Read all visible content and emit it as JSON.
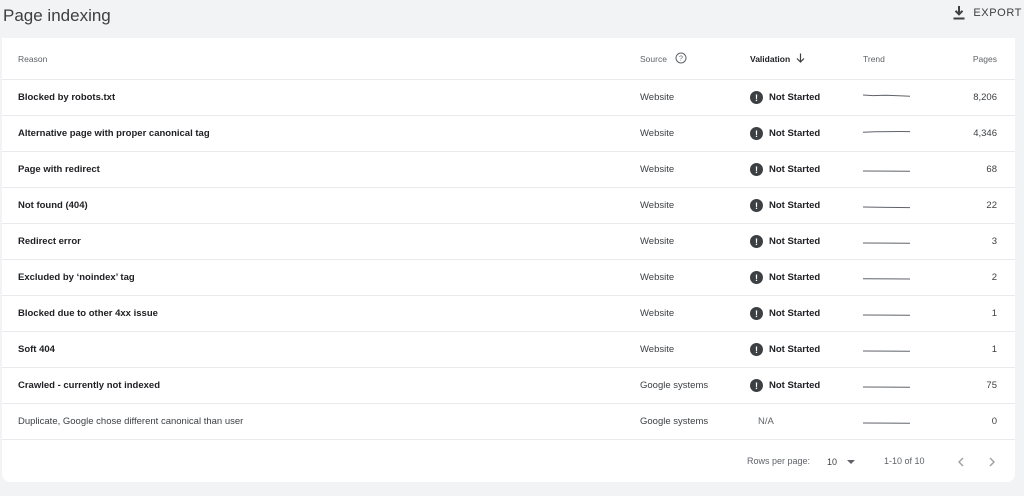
{
  "header": {
    "title": "Page indexing",
    "export_label": "EXPORT"
  },
  "table": {
    "columns": {
      "reason": "Reason",
      "source": "Source",
      "validation": "Validation",
      "trend": "Trend",
      "pages": "Pages"
    },
    "rows": [
      {
        "reason": "Blocked by robots.txt",
        "source": "Website",
        "validation": "Not Started",
        "pages": "8,206"
      },
      {
        "reason": "Alternative page with proper canonical tag",
        "source": "Website",
        "validation": "Not Started",
        "pages": "4,346"
      },
      {
        "reason": "Page with redirect",
        "source": "Website",
        "validation": "Not Started",
        "pages": "68"
      },
      {
        "reason": "Not found (404)",
        "source": "Website",
        "validation": "Not Started",
        "pages": "22"
      },
      {
        "reason": "Redirect error",
        "source": "Website",
        "validation": "Not Started",
        "pages": "3"
      },
      {
        "reason": "Excluded by ‘noindex’ tag",
        "source": "Website",
        "validation": "Not Started",
        "pages": "2"
      },
      {
        "reason": "Blocked due to other 4xx issue",
        "source": "Website",
        "validation": "Not Started",
        "pages": "1"
      },
      {
        "reason": "Soft 404",
        "source": "Website",
        "validation": "Not Started",
        "pages": "1"
      },
      {
        "reason": "Crawled - currently not indexed",
        "source": "Google systems",
        "validation": "Not Started",
        "pages": "75"
      },
      {
        "reason": "Duplicate, Google chose different canonical than user",
        "source": "Google systems",
        "validation": "N/A",
        "pages": "0"
      }
    ]
  },
  "pagination": {
    "rows_per_page_label": "Rows per page:",
    "rows_per_page_value": "10",
    "range_text": "1-10 of 10"
  },
  "colors": {
    "background": "#f1f3f4",
    "card": "#ffffff",
    "status_icon": "#3c4043",
    "divider": "#e8eaed"
  },
  "icons": {
    "export": "download-icon",
    "source_help": "help-circle-icon",
    "sort": "arrow-down-icon",
    "status": "exclamation-circle-icon",
    "prev": "chevron-left-icon",
    "next": "chevron-right-icon"
  }
}
